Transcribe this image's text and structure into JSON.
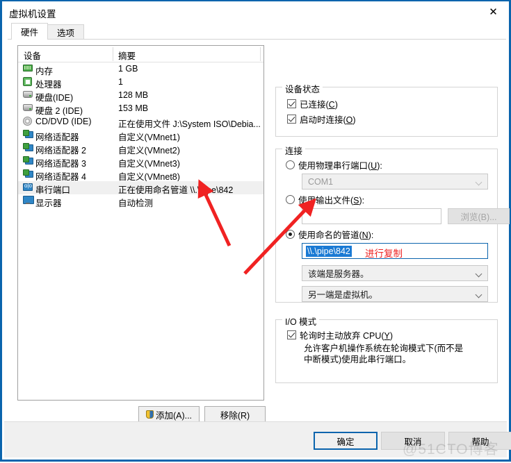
{
  "window": {
    "title": "虚拟机设置",
    "close_label": "✕",
    "accent_color": "#0a64ad"
  },
  "tabs": [
    {
      "label": "硬件",
      "active": true
    },
    {
      "label": "选项",
      "active": false
    }
  ],
  "device_list": {
    "headers": {
      "device": "设备",
      "summary": "摘要"
    },
    "rows": [
      {
        "icon": "memory-icon",
        "name": "内存",
        "summary": "1 GB",
        "selected": false
      },
      {
        "icon": "processor-icon",
        "name": "处理器",
        "summary": "1",
        "selected": false
      },
      {
        "icon": "harddisk-icon",
        "name": "硬盘(IDE)",
        "summary": "128 MB",
        "selected": false
      },
      {
        "icon": "harddisk-icon",
        "name": "硬盘 2 (IDE)",
        "summary": "153 MB",
        "selected": false
      },
      {
        "icon": "cddvd-icon",
        "name": "CD/DVD (IDE)",
        "summary": "正在使用文件 J:\\System ISO\\Debia...",
        "selected": false
      },
      {
        "icon": "network-adapter-icon",
        "name": "网络适配器",
        "summary": "自定义(VMnet1)",
        "selected": false
      },
      {
        "icon": "network-adapter-icon",
        "name": "网络适配器 2",
        "summary": "自定义(VMnet2)",
        "selected": false
      },
      {
        "icon": "network-adapter-icon",
        "name": "网络适配器 3",
        "summary": "自定义(VMnet3)",
        "selected": false
      },
      {
        "icon": "network-adapter-icon",
        "name": "网络适配器 4",
        "summary": "自定义(VMnet8)",
        "selected": false
      },
      {
        "icon": "serial-port-icon",
        "name": "串行端口",
        "summary": "正在使用命名管道 \\\\.\\pipe\\842",
        "selected": true
      },
      {
        "icon": "display-icon",
        "name": "显示器",
        "summary": "自动检测",
        "selected": false
      }
    ]
  },
  "list_buttons": {
    "add": "添加(A)...",
    "remove": "移除(R)"
  },
  "device_status": {
    "title": "设备状态",
    "connected": {
      "label": "已连接(C)",
      "checked": true
    },
    "connect_at_power_on": {
      "label": "启动时连接(O)",
      "checked": true
    }
  },
  "connection": {
    "title": "连接",
    "use_physical_port": {
      "label": "使用物理串行端口(U):",
      "selected": false
    },
    "physical_port_value": "COM1",
    "use_output_file": {
      "label": "使用输出文件(S):",
      "selected": false
    },
    "output_file_value": "",
    "browse_button": "浏览(B)...",
    "use_named_pipe": {
      "label": "使用命名的管道(N):",
      "selected": true
    },
    "named_pipe_value": "\\\\.\\pipe\\842",
    "end_role": "该端是服务器。",
    "other_end": "另一端是虚拟机。",
    "annotation": "进行复制",
    "annotation_color": "#ee2222"
  },
  "io_mode": {
    "title": "I/O 模式",
    "yield_cpu": {
      "label": "轮询时主动放弃 CPU(Y)",
      "checked": true
    },
    "description": "允许客户机操作系统在轮询模式下(而不是中断模式)使用此串行端口。"
  },
  "footer_buttons": {
    "ok": "确定",
    "cancel": "取消",
    "help": "帮助"
  },
  "watermark": "@51CTO博客"
}
